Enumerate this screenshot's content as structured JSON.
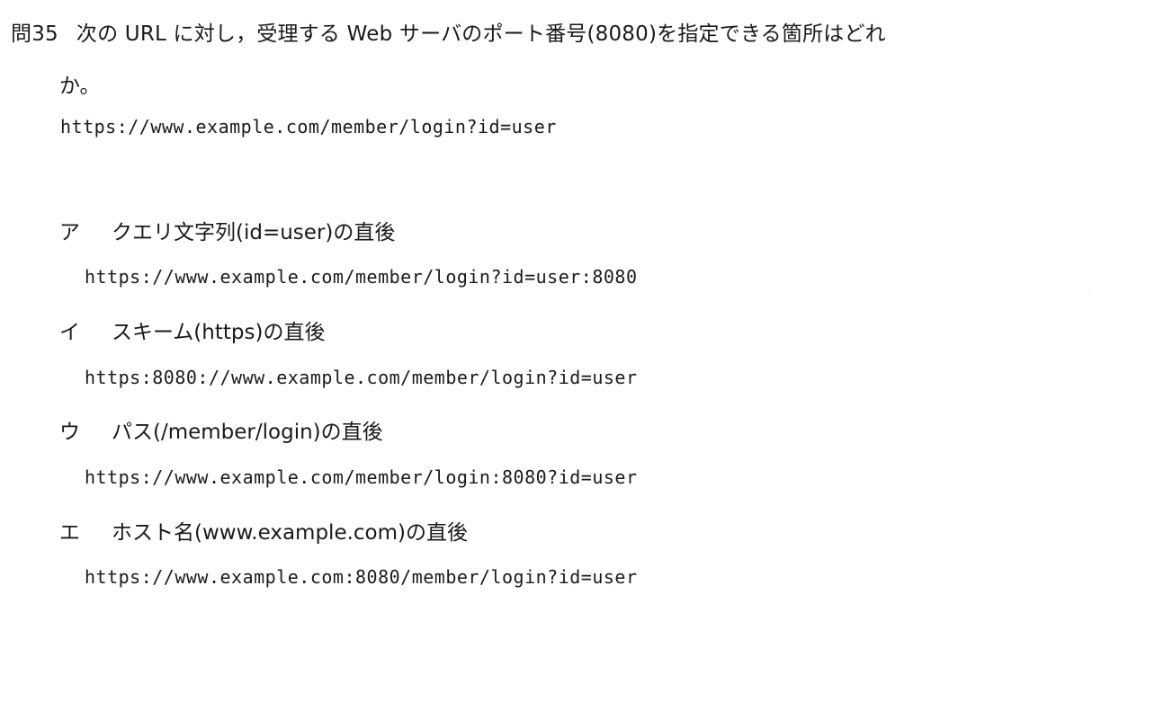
{
  "question": {
    "number": "問35",
    "text_line1": "次の URL に対し，受理する Web サーバのポート番号(8080)を指定できる箇所はどれ",
    "text_line2": "か。",
    "url": "https://www.example.com/member/login?id=user"
  },
  "choices": [
    {
      "label": "ア",
      "text": "クエリ文字列(id=user)の直後",
      "url": "https://www.example.com/member/login?id=user:8080"
    },
    {
      "label": "イ",
      "text": "スキーム(https)の直後",
      "url": "https:8080://www.example.com/member/login?id=user"
    },
    {
      "label": "ウ",
      "text": "パス(/member/login)の直後",
      "url": "https://www.example.com/member/login:8080?id=user"
    },
    {
      "label": "エ",
      "text": "ホスト名(www.example.com)の直後",
      "url": "https://www.example.com:8080/member/login?id=user"
    }
  ]
}
